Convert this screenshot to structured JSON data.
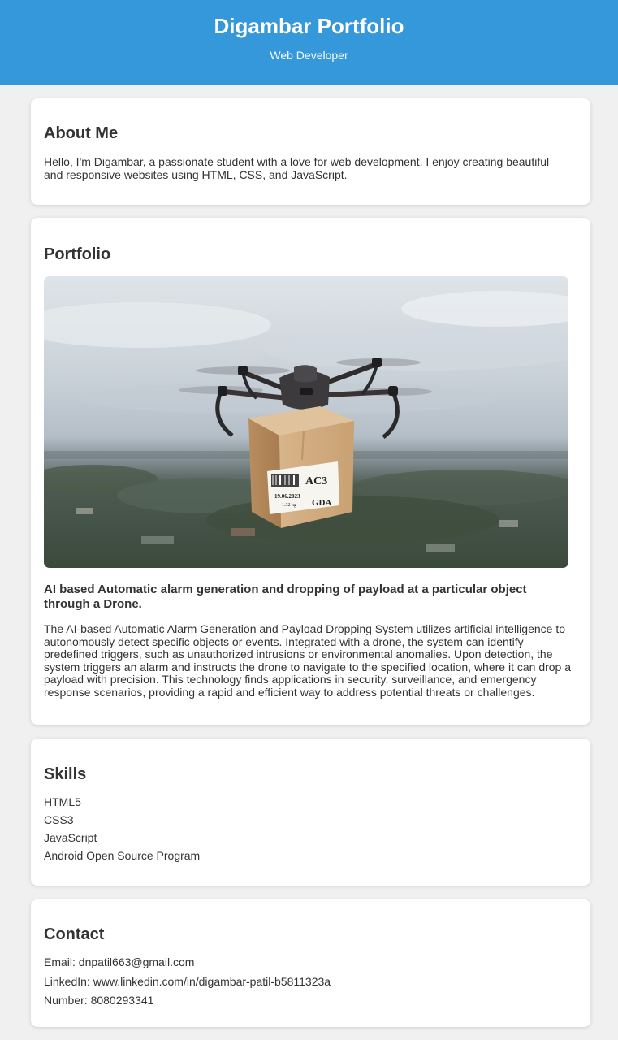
{
  "header": {
    "title": "Digambar Portfolio",
    "subtitle": "Web Developer",
    "background_color": "#3498db"
  },
  "about": {
    "heading": "About Me",
    "text": "Hello, I'm Digambar, a passionate student with a love for web development. I enjoy creating beautiful and responsive websites using HTML, CSS, and JavaScript."
  },
  "portfolio": {
    "heading": "Portfolio",
    "project": {
      "image_icon": "drone-delivery-photo",
      "package_label": "AC3",
      "package_label_2": "GDA",
      "package_date": "19.06.2023",
      "package_weight": "1.32 kg",
      "title": "AI based Automatic alarm generation and dropping of payload at a particular object through a Drone.",
      "description": "The AI-based Automatic Alarm Generation and Payload Dropping System utilizes artificial intelligence to autonomously detect specific objects or events. Integrated with a drone, the system can identify predefined triggers, such as unauthorized intrusions or environmental anomalies. Upon detection, the system triggers an alarm and instructs the drone to navigate to the specified location, where it can drop a payload with precision. This technology finds applications in security, surveillance, and emergency response scenarios, providing a rapid and efficient way to address potential threats or challenges."
    }
  },
  "skills": {
    "heading": "Skills",
    "items": [
      "HTML5",
      "CSS3",
      "JavaScript",
      "Android Open Source Program"
    ]
  },
  "contact": {
    "heading": "Contact",
    "email": "Email: dnpatil663@gmail.com",
    "linkedin": "LinkedIn: www.linkedin.com/in/digambar-patil-b5811323a",
    "number": "Number: 8080293341"
  }
}
